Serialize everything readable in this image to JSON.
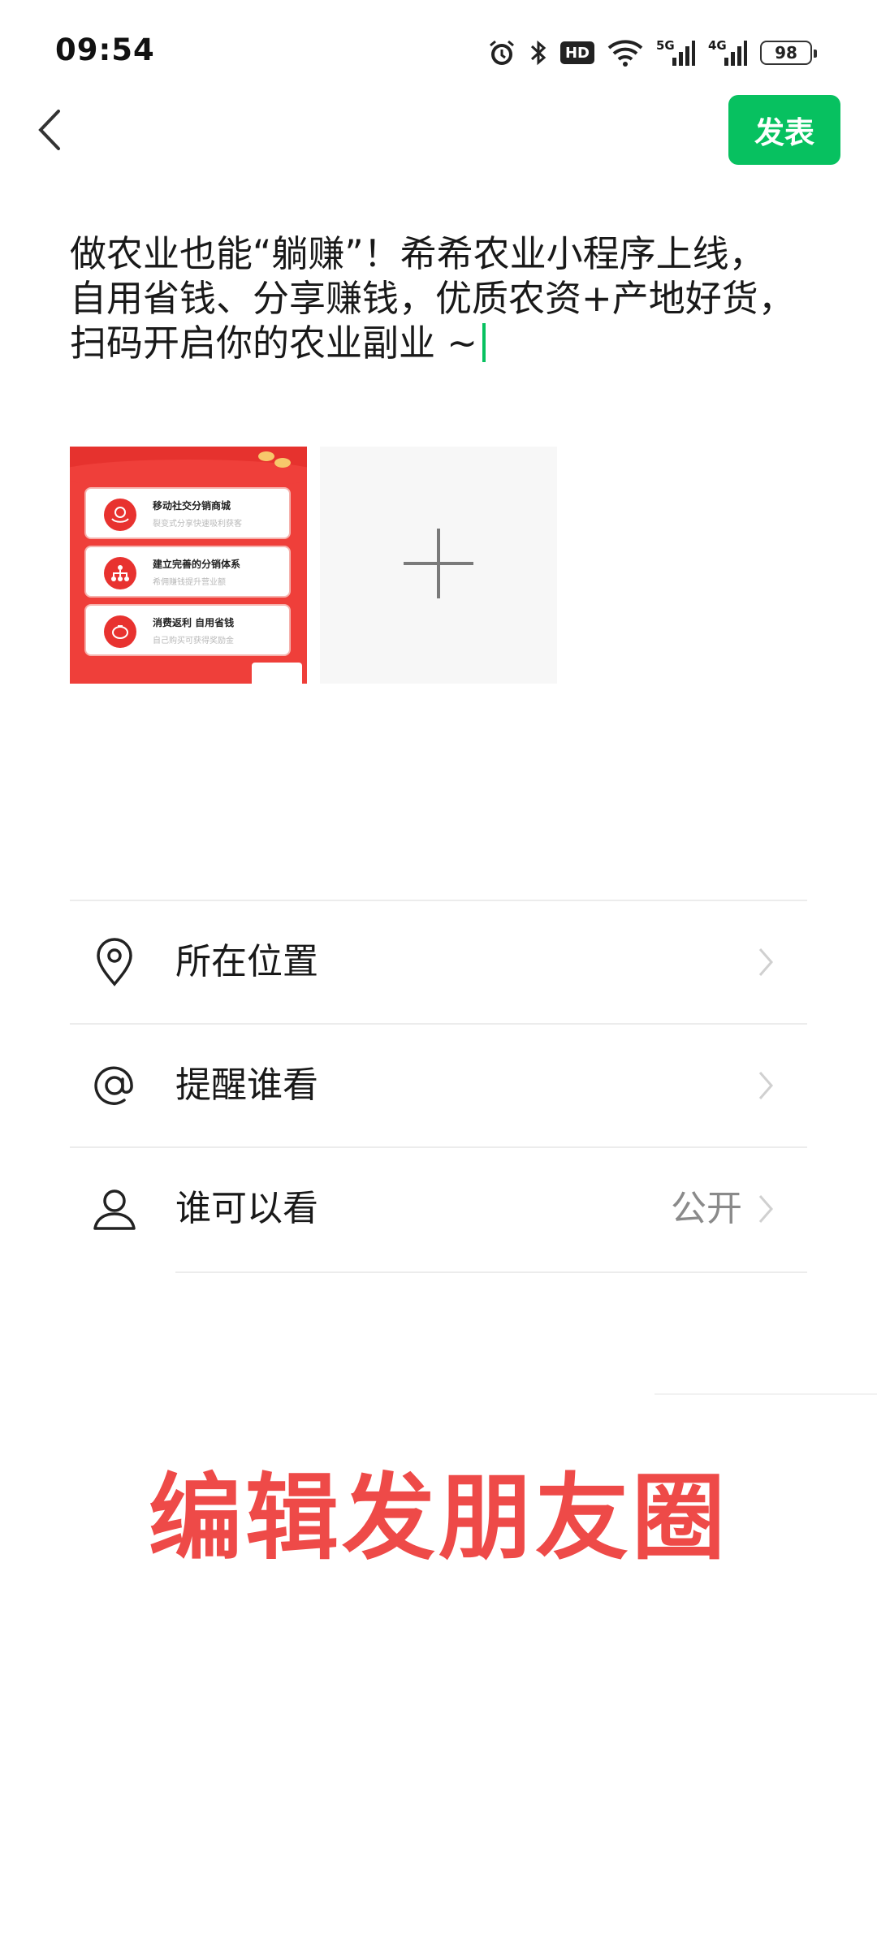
{
  "status_bar": {
    "time": "09:54",
    "icons": [
      "alarm-icon",
      "bluetooth-icon",
      "hd-icon",
      "wifi-icon",
      "5g-signal-icon",
      "4g-signal-icon",
      "battery-icon"
    ],
    "hd_label": "HD",
    "network_5g": "5G",
    "network_4g": "4G",
    "battery": "98"
  },
  "header": {
    "back_icon": "chevron-left-icon",
    "publish_label": "发表",
    "accent_color": "#07c160"
  },
  "post": {
    "text": "做农业也能“躺赚”！希希农业小程序上线，\n自用省钱、分享赚钱，优质农资+产地好货，\n扫码开启你的农业副业 ~"
  },
  "images": {
    "thumbnail": {
      "cards": [
        {
          "title": "移动社交分销商城",
          "subtitle": "裂变式分享快速吸利获客"
        },
        {
          "title": "建立完善的分销体系",
          "subtitle": "希佣赚钱提升营业额"
        },
        {
          "title": "消费返利 自用省钱",
          "subtitle": "自己购买可获得奖励金"
        }
      ]
    },
    "add_icon": "plus-icon"
  },
  "options": [
    {
      "icon": "location-pin-icon",
      "label": "所在位置",
      "value": ""
    },
    {
      "icon": "at-sign-icon",
      "label": "提醒谁看",
      "value": ""
    },
    {
      "icon": "person-icon",
      "label": "谁可以看",
      "value": "公开"
    }
  ],
  "overlay": {
    "caption": "编辑发朋友圈",
    "color": "#ee4a48"
  }
}
